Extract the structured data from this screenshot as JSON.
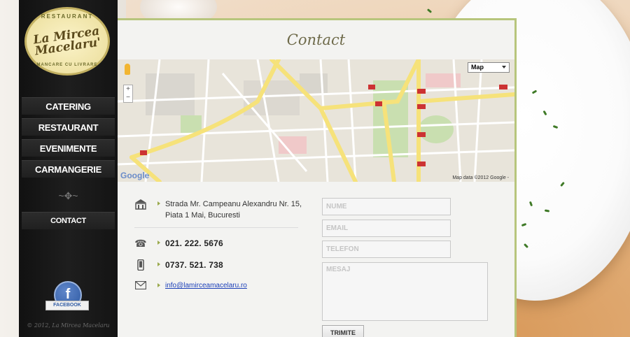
{
  "logo": {
    "top_text": "RESTAURANT",
    "name": "La Mircea Macelaru'",
    "bottom_text": "MANCARE CU LIVRARE"
  },
  "nav": {
    "items": [
      {
        "label": "CATERING"
      },
      {
        "label": "RESTAURANT"
      },
      {
        "label": "EVENIMENTE"
      },
      {
        "label": "CARMANGERIE"
      },
      {
        "label": "CONTACT"
      }
    ],
    "ornament": "~✥~"
  },
  "facebook": {
    "letter": "f",
    "label": "FACEBOOK"
  },
  "copyright": "© 2012, La Mircea Macelaru",
  "page": {
    "title": "Contact"
  },
  "map": {
    "type_label": "Map",
    "zoom_in": "+",
    "zoom_out": "−",
    "provider": "Google",
    "attribution": "Map data ©2012 Google -"
  },
  "contact": {
    "address_line1": "Strada Mr. Campeanu Alexandru Nr. 15,",
    "address_line2": "Piata 1 Mai, Bucuresti",
    "phone": "021. 222. 5676",
    "mobile": "0737. 521. 738",
    "email": "info@lamirceamacelaru.ro"
  },
  "form": {
    "name_placeholder": "NUME",
    "email_placeholder": "EMAIL",
    "phone_placeholder": "TELEFON",
    "message_placeholder": "MESAJ",
    "submit_label": "TRIMITE"
  }
}
